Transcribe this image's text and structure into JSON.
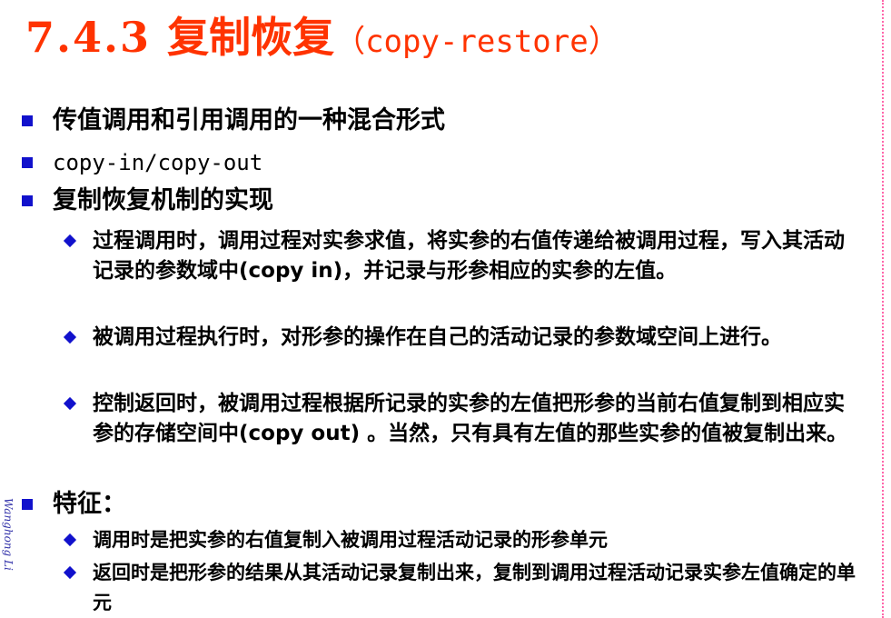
{
  "title": {
    "number": "7.4.3 ",
    "chinese": "复制恢复",
    "english": "（copy-restore）"
  },
  "side_text": "Wanghong Li",
  "items": [
    {
      "text": "传值调用和引用调用的一种混合形式"
    },
    {
      "text": "copy-in/copy-out"
    },
    {
      "text": "复制恢复机制的实现",
      "subitems": [
        {
          "text": "过程调用时，调用过程对实参求值，将实参的右值传递给被调用过程，写入其活动记录的参数域中(copy in)，并记录与形参相应的实参的左值。"
        },
        {
          "text": "被调用过程执行时，对形参的操作在自己的活动记录的参数域空间上进行。"
        },
        {
          "text": "控制返回时，被调用过程根据所记录的实参的左值把形参的当前右值复制到相应实参的存储空间中(copy out) 。当然，只有具有左值的那些实参的值被复制出来。"
        }
      ]
    },
    {
      "text": "特征：",
      "subitems": [
        {
          "text": "调用时是把实参的右值复制入被调用过程活动记录的形参单元"
        },
        {
          "text": "返回时是把形参的结果从其活动记录复制出来，复制到调用过程活动记录实参左值确定的单元"
        }
      ]
    }
  ]
}
